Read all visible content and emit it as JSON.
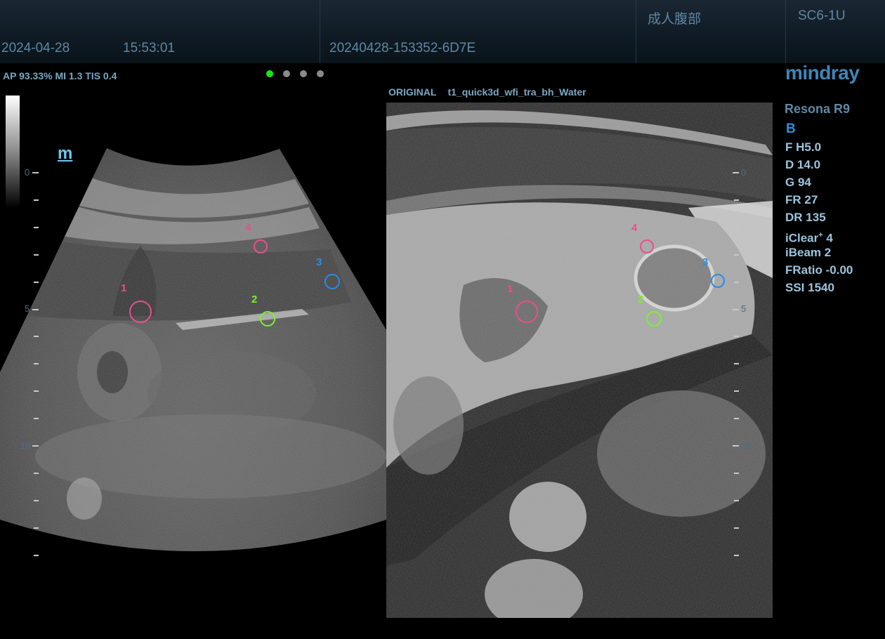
{
  "header": {
    "date": "2024-04-28",
    "time": "15:53:01",
    "patient_id": "20240428-153352-6D7E",
    "exam_preset": "成人腹部",
    "probe": "SC6-1U"
  },
  "status": {
    "acoustic": "AP 93.33%  MI 1.3 TIS 0.4",
    "page_dots": 4,
    "active_dot": 1
  },
  "left_image": {
    "orientation_mark": "m",
    "depth_labels": [
      "0",
      "5",
      "10"
    ]
  },
  "right_image": {
    "label_left": "ORIGINAL",
    "label_right": "t1_quick3d_wfi_tra_bh_Water",
    "depth_labels": [
      "0",
      "5",
      "10"
    ]
  },
  "markers": [
    {
      "num": "1",
      "color": "#e8508a"
    },
    {
      "num": "2",
      "color": "#7cf032"
    },
    {
      "num": "3",
      "color": "#2a8ce6"
    },
    {
      "num": "4",
      "color": "#e8508a"
    }
  ],
  "side_panel": {
    "brand": "mindray",
    "model": "Resona R9",
    "mode": "B",
    "params": [
      {
        "name": "F",
        "value": "H5.0"
      },
      {
        "name": "D",
        "value": "14.0"
      },
      {
        "name": "G",
        "value": "94"
      },
      {
        "name": "FR",
        "value": "27"
      },
      {
        "name": "DR",
        "value": "135"
      },
      {
        "name": "iClear",
        "sup": "+",
        "value": "4"
      },
      {
        "name": "iBeam",
        "value": "2"
      },
      {
        "name": "FRatio",
        "value": "-0.00"
      },
      {
        "name": "SSI",
        "value": "1540"
      }
    ]
  }
}
